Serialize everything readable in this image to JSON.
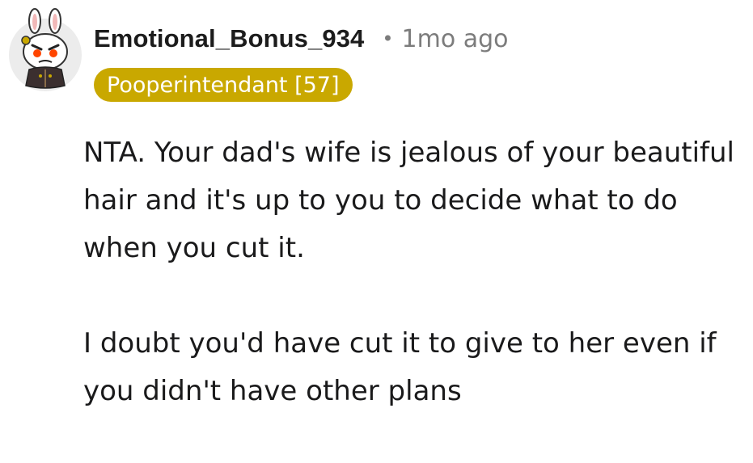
{
  "comment": {
    "username": "Emotional_Bonus_934",
    "separator": "•",
    "timestamp": "1mo ago",
    "flair": "Pooperintendant [57]",
    "paragraphs": [
      "NTA. Your dad's wife is jealous of your beautiful hair and it's up to you to decide what to do when you cut it.",
      "I doubt you'd have cut it to give to her even if you didn't have other plans"
    ]
  },
  "colors": {
    "flair_background": "#c9a800",
    "flair_text": "#ffffff",
    "meta_text": "#7c7c7c",
    "body_text": "#1a1a1b"
  },
  "icons": {
    "avatar": "snoo-avatar-icon"
  }
}
